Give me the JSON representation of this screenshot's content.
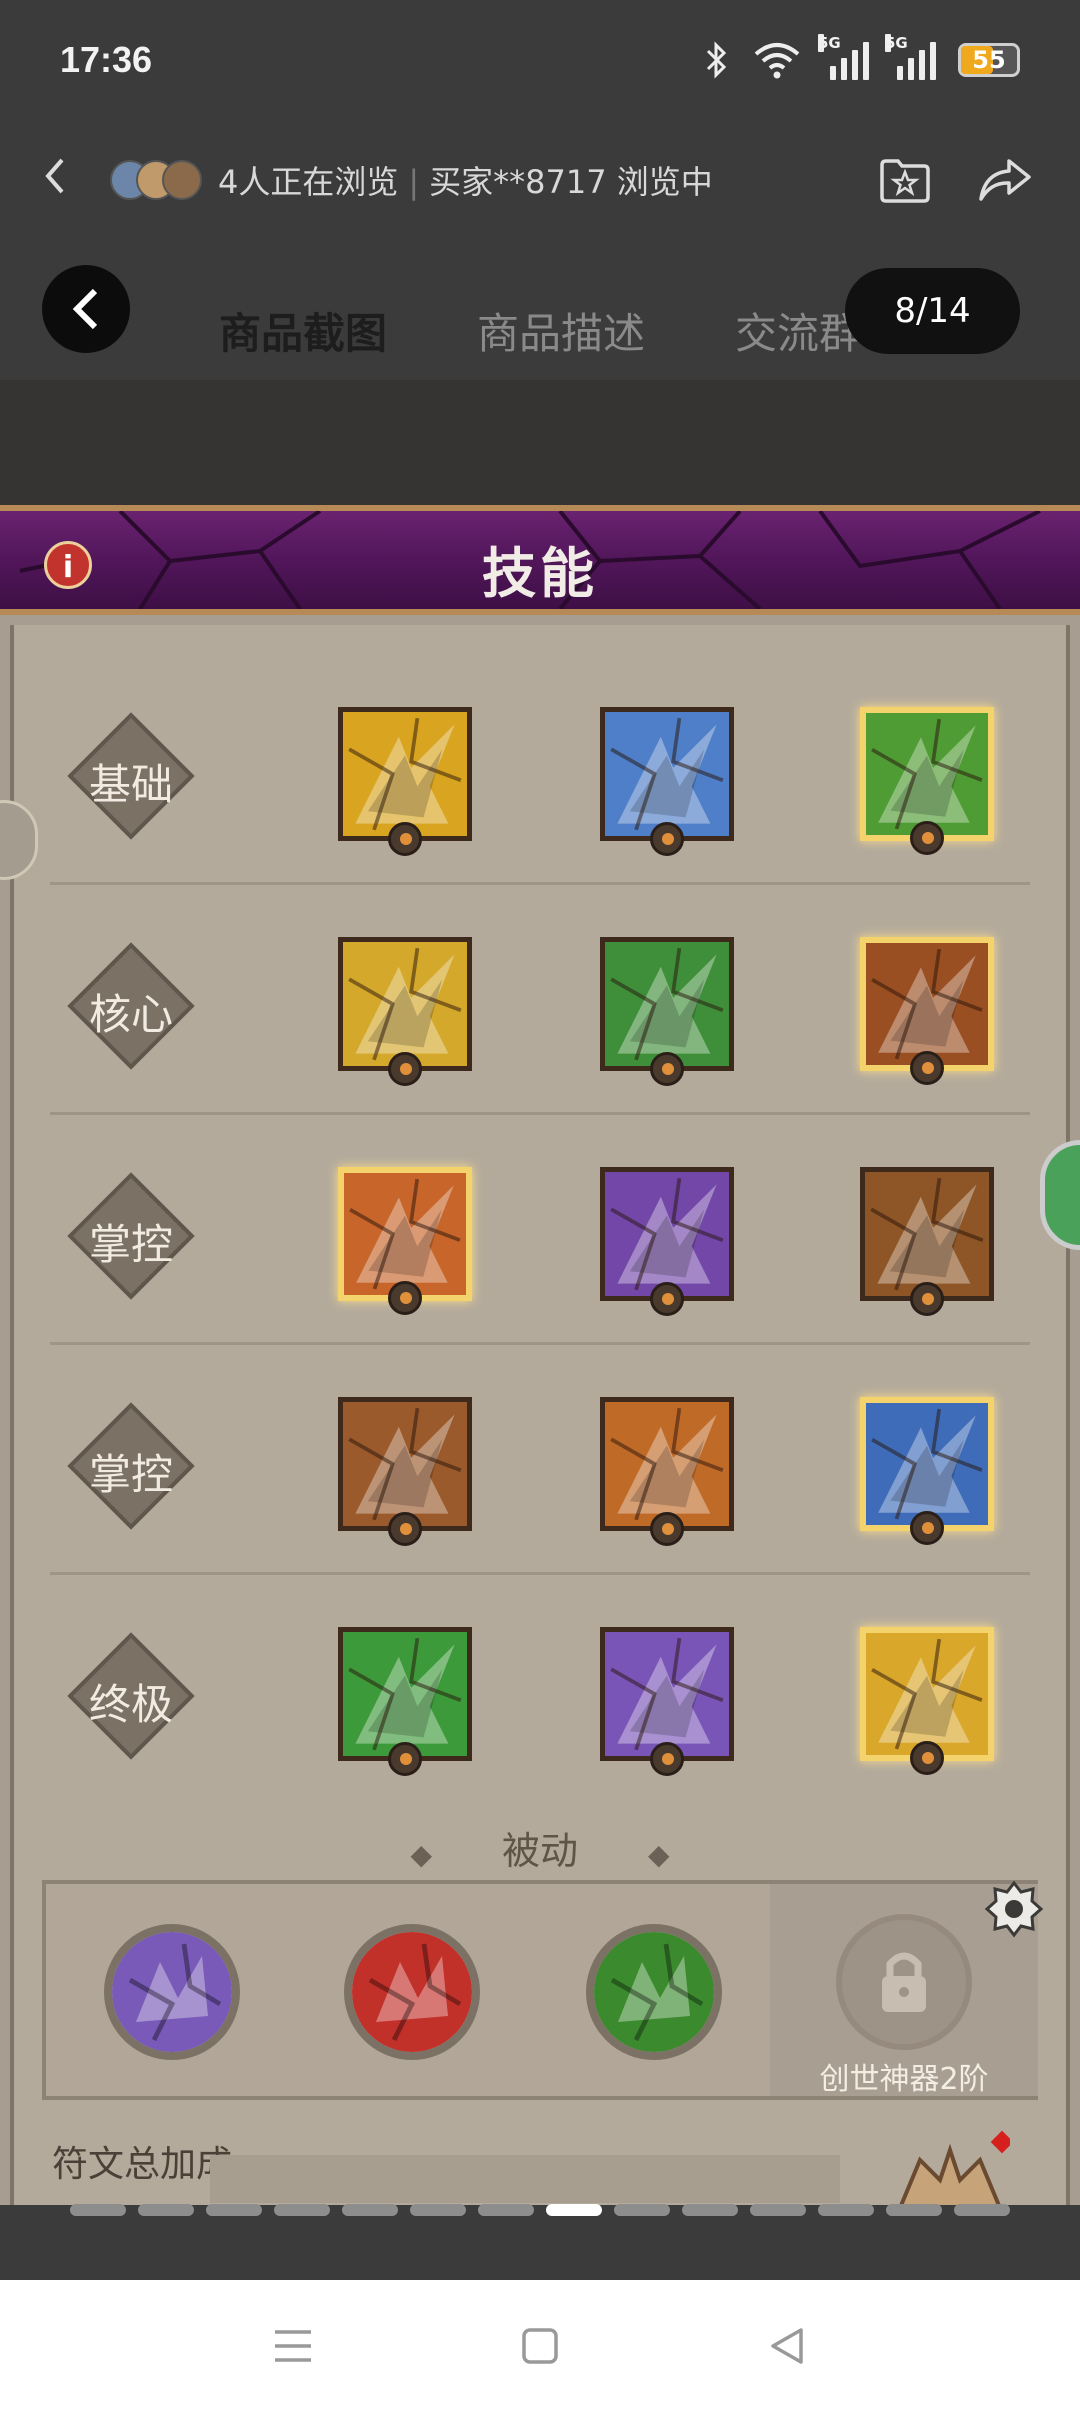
{
  "status": {
    "time": "17:36",
    "network1": "5G",
    "network2": "5G",
    "battery": "55"
  },
  "header": {
    "viewers_text": "4人正在浏览",
    "buyer_text": "买家**8717 浏览中"
  },
  "tabs": [
    {
      "label": "商品截图",
      "active": true
    },
    {
      "label": "商品描述",
      "active": false
    },
    {
      "label": "交流群",
      "active": false
    }
  ],
  "pager": "8/14",
  "game": {
    "title": "技能",
    "info_glyph": "i",
    "rows": [
      {
        "label": "基础",
        "skills": [
          {
            "icon": "golden-axe-icon",
            "color": "#d9a520",
            "gold": false
          },
          {
            "icon": "ice-hammer-icon",
            "color": "#4f7fc8",
            "gold": false
          },
          {
            "icon": "nature-strike-icon",
            "color": "#4f9b34",
            "gold": true
          }
        ]
      },
      {
        "label": "核心",
        "skills": [
          {
            "icon": "golden-whirl-icon",
            "color": "#d4a82a",
            "gold": false
          },
          {
            "icon": "green-slash-icon",
            "color": "#3f8f3a",
            "gold": false
          },
          {
            "icon": "fire-totem-icon",
            "color": "#9a4f22",
            "gold": true
          }
        ]
      },
      {
        "label": "掌控",
        "skills": [
          {
            "icon": "meteor-icon",
            "color": "#c7652a",
            "gold": true
          },
          {
            "icon": "arcane-burst-icon",
            "color": "#7247a8",
            "gold": false
          },
          {
            "icon": "earth-crack-icon",
            "color": "#8e5526",
            "gold": false
          }
        ]
      },
      {
        "label": "掌控",
        "skills": [
          {
            "icon": "earth-golem-icon",
            "color": "#9a5a2c",
            "gold": false
          },
          {
            "icon": "roaring-beast-icon",
            "color": "#c06a28",
            "gold": false
          },
          {
            "icon": "frost-beast-icon",
            "color": "#3f6cb8",
            "gold": true
          }
        ]
      },
      {
        "label": "终极",
        "skills": [
          {
            "icon": "wind-dragon-icon",
            "color": "#3d9a3a",
            "gold": false
          },
          {
            "icon": "arcane-demon-icon",
            "color": "#7a55b8",
            "gold": false
          },
          {
            "icon": "golden-spirit-icon",
            "color": "#d9a72a",
            "gold": true
          }
        ]
      }
    ],
    "passive": {
      "title": "被动",
      "items": [
        {
          "icon": "crystal-passive-icon",
          "color": "#7a5ab8"
        },
        {
          "icon": "flame-face-passive-icon",
          "color": "#c2302a"
        },
        {
          "icon": "lightning-passive-icon",
          "color": "#3c8a2e"
        }
      ],
      "locked_label": "创世神器2阶"
    },
    "runes_label": "符文总加成"
  },
  "carousel": {
    "count": 14,
    "active": 8
  }
}
